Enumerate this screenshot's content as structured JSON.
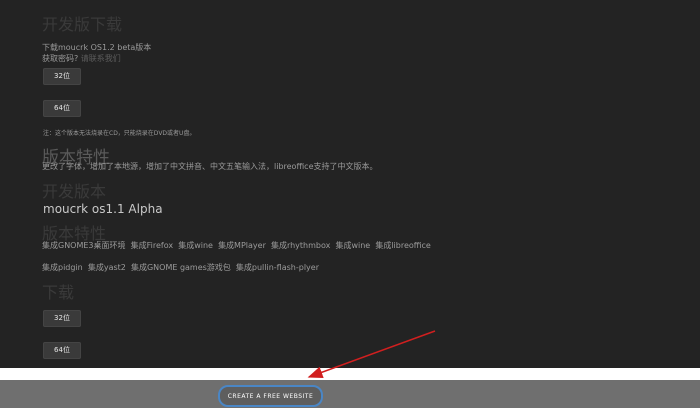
{
  "top_section": {
    "faded_heading": "开发版下载",
    "download_line": "下载moucrk OS1.2 beta版本",
    "password_prefix": "获取密码?",
    "password_link": "请联系我们",
    "button_32": "32位",
    "button_64": "64位",
    "note": "注：这个版本无法烧录在CD，只能烧录在DVD或者U盘。"
  },
  "features_section": {
    "heading": "版本特性",
    "description": "更改了字体，增加了本地源，增加了中文拼音、中文五笔输入法，libreoffice支持了中文版本。"
  },
  "older_section": {
    "faded_heading": "开发版本",
    "version_title": "moucrk os1.1 Alpha",
    "faded_subheading": "版本特性",
    "features_row1": [
      "集成GNOME3桌面环境",
      "集成Firefox",
      "集成wine",
      "集成MPlayer",
      "集成rhythmbox",
      "集成wine",
      "集成libreoffice"
    ],
    "features_row2": [
      "集成pidgin",
      "集成yast2",
      "集成GNOME games游戏包",
      "集成pullin-flash-plyer"
    ],
    "faded_download": "下载",
    "button_32": "32位",
    "button_64": "64位"
  },
  "footer": {
    "cta_label": "CREATE A FREE WEBSITE",
    "cta_border_color": "#4a86c5"
  },
  "annotation": {
    "arrow_color": "#d11f1f",
    "icon": "arrow-icon"
  }
}
